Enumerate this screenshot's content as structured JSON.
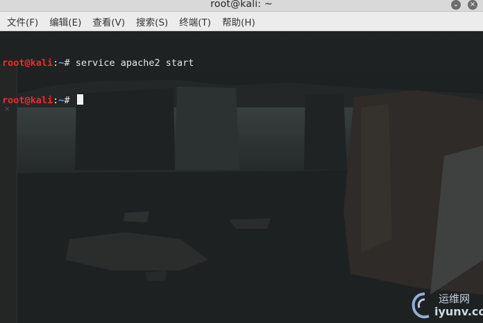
{
  "window": {
    "title": "root@kali: ~",
    "minimize_glyph": "⌄",
    "close_glyph": "×"
  },
  "menu": [
    {
      "label": "文件(F)"
    },
    {
      "label": "编辑(E)"
    },
    {
      "label": "查看(V)"
    },
    {
      "label": "搜索(S)"
    },
    {
      "label": "终端(T)"
    },
    {
      "label": "帮助(H)"
    }
  ],
  "terminal": {
    "lines": [
      {
        "user": "root@kali",
        "sep": ":",
        "path": "~",
        "prompt": "# ",
        "command": "service apache2 start"
      },
      {
        "user": "root@kali",
        "sep": ":",
        "path": "~",
        "prompt": "# ",
        "command": ""
      }
    ]
  },
  "side_tab": {
    "close_glyph": "×"
  },
  "watermark": {
    "line1": "运维网",
    "line2": "iyunv.com"
  },
  "colors": {
    "user": "#ee2b2b",
    "path": "#6da1ff",
    "text": "#e8e8e8"
  }
}
